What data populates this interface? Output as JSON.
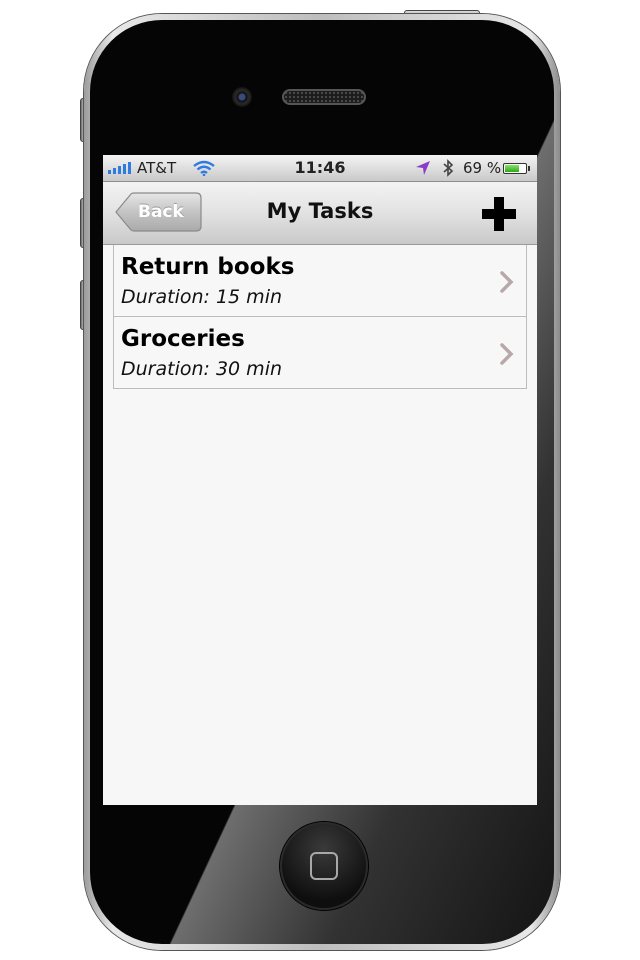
{
  "status_bar": {
    "carrier": "AT&T",
    "time": "11:46",
    "battery_percent": "69 %",
    "battery_level": 0.69,
    "signal_bars": 5,
    "icons": [
      "signal-icon",
      "wifi-icon",
      "location-icon",
      "bluetooth-icon",
      "battery-icon"
    ]
  },
  "nav": {
    "title": "My Tasks",
    "back_label": "Back",
    "add_icon": "plus-icon"
  },
  "tasks": [
    {
      "title": "Return books",
      "duration": "Duration: 15 min"
    },
    {
      "title": "Groceries",
      "duration": "Duration: 30 min"
    }
  ],
  "colors": {
    "signal": "#2f7be0",
    "wifi": "#2f7be0",
    "location": "#8a3cc8",
    "battery": "#2fa81a",
    "chevron": "#b7a9a9"
  }
}
